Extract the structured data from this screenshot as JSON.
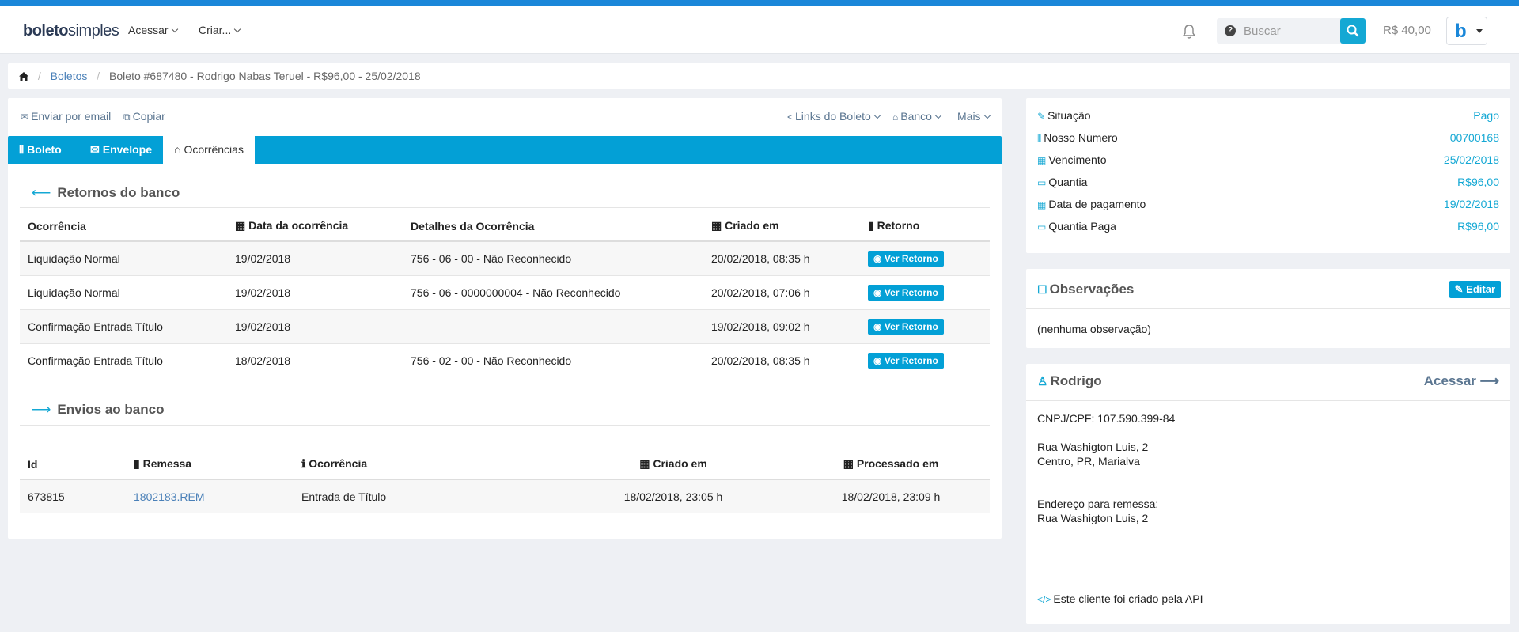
{
  "app": {
    "logo_bold": "boleto",
    "logo_light": "simples"
  },
  "nav": {
    "acessar": "Acessar",
    "criar": "Criar..."
  },
  "search": {
    "placeholder": "Buscar"
  },
  "balance": "R$ 40,00",
  "avatar_letter": "b",
  "breadcrumb": {
    "boletos": "Boletos",
    "current": "Boleto #687480 - Rodrigo Nabas Teruel - R$96,00 - 25/02/2018"
  },
  "toolbar": {
    "email": "Enviar por email",
    "copy": "Copiar",
    "links": "Links do Boleto",
    "banco": "Banco",
    "mais": "Mais"
  },
  "tabs": [
    {
      "label": "Boleto"
    },
    {
      "label": "Envelope"
    },
    {
      "label": "Ocorrências"
    }
  ],
  "retornos": {
    "title": "Retornos do banco",
    "headers": [
      "Ocorrência",
      "Data da ocorrência",
      "Detalhes da Ocorrência",
      "Criado em",
      "Retorno"
    ],
    "button": "Ver Retorno",
    "rows": [
      [
        "Liquidação Normal",
        "19/02/2018",
        "756 - 06 - 00 - Não Reconhecido",
        "20/02/2018, 08:35 h"
      ],
      [
        "Liquidação Normal",
        "19/02/2018",
        "756 - 06 - 0000000004 - Não Reconhecido",
        "20/02/2018, 07:06 h"
      ],
      [
        "Confirmação Entrada Título",
        "19/02/2018",
        "",
        "19/02/2018, 09:02 h"
      ],
      [
        "Confirmação Entrada Título",
        "18/02/2018",
        "756 - 02 - 00 - Não Reconhecido",
        "20/02/2018, 08:35 h"
      ]
    ]
  },
  "envios": {
    "title": "Envios ao banco",
    "headers": [
      "Id",
      "Remessa",
      "Ocorrência",
      "Criado em",
      "Processado em"
    ],
    "rows": [
      [
        "673815",
        "1802183.REM",
        "Entrada de Título",
        "18/02/2018, 23:05 h",
        "18/02/2018, 23:09 h"
      ]
    ]
  },
  "info": [
    {
      "label": "Situação",
      "value": "Pago",
      "icon": "edit-icon"
    },
    {
      "label": "Nosso Número",
      "value": "00700168",
      "icon": "barcode-icon"
    },
    {
      "label": "Vencimento",
      "value": "25/02/2018",
      "icon": "calendar-icon"
    },
    {
      "label": "Quantia",
      "value": "R$96,00",
      "icon": "money-icon"
    },
    {
      "label": "Data de pagamento",
      "value": "19/02/2018",
      "icon": "calendar-icon"
    },
    {
      "label": "Quantia Paga",
      "value": "R$96,00",
      "icon": "money-icon"
    }
  ],
  "observacoes": {
    "title": "Observações",
    "edit": "Editar",
    "text": "(nenhuma observação)"
  },
  "customer": {
    "name": "Rodrigo",
    "acessar": "Acessar",
    "cnpj": "CNPJ/CPF: 107.590.399-84",
    "address1": "Rua Washigton Luis, 2",
    "address2": "Centro, PR, Marialva",
    "remessa_label": "Endereço para remessa:",
    "remessa_addr": "Rua Washigton Luis, 2",
    "api_note": "Este cliente foi criado pela API"
  },
  "colors": {
    "accent": "#03a0d6",
    "link": "#4a80b8",
    "top": "#1a87d9"
  }
}
